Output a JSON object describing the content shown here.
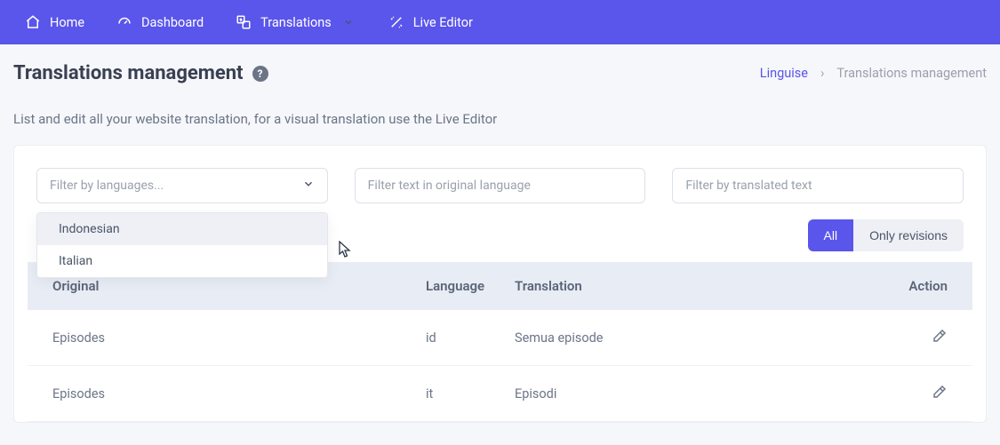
{
  "nav": {
    "home": "Home",
    "dashboard": "Dashboard",
    "translations": "Translations",
    "liveEditor": "Live Editor"
  },
  "header": {
    "title": "Translations management",
    "breadcrumbLink": "Linguise",
    "breadcrumbSep": "›",
    "breadcrumbCurrent": "Translations management"
  },
  "subtitle": "List and edit all your website translation, for a visual translation use the Live Editor",
  "filters": {
    "languagesPlaceholder": "Filter by languages...",
    "originalPlaceholder": "Filter text in original language",
    "translatedPlaceholder": "Filter by translated text",
    "dropdownOptions": [
      "Indonesian",
      "Italian"
    ]
  },
  "toggle": {
    "all": "All",
    "revisions": "Only revisions"
  },
  "table": {
    "headers": {
      "original": "Original",
      "language": "Language",
      "translation": "Translation",
      "action": "Action"
    },
    "rows": [
      {
        "original": "Episodes",
        "language": "id",
        "translation": "Semua episode"
      },
      {
        "original": "Episodes",
        "language": "it",
        "translation": "Episodi"
      }
    ]
  }
}
